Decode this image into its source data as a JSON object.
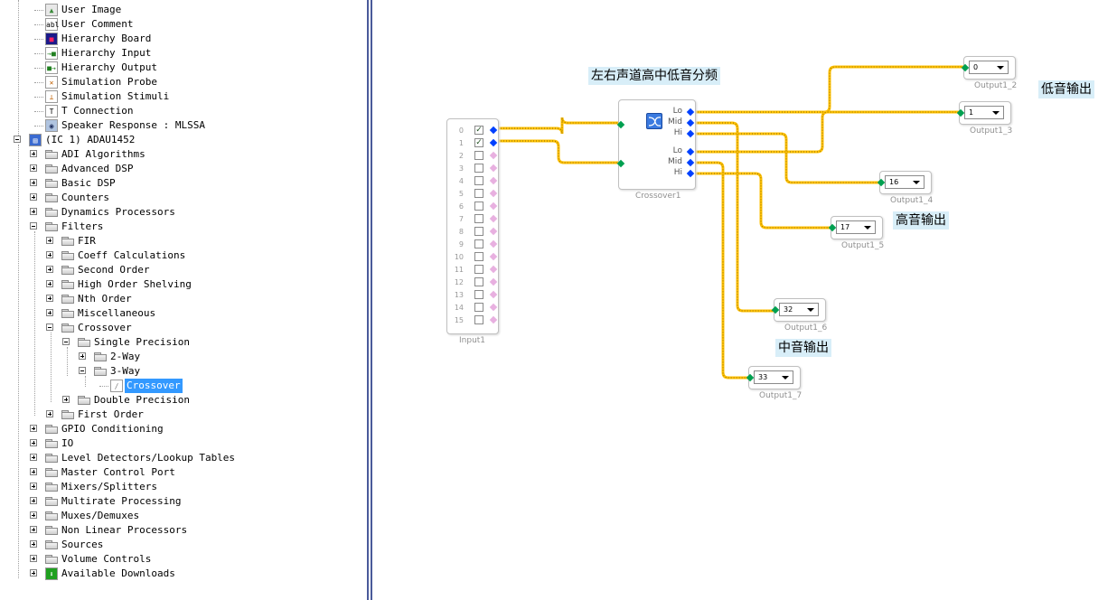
{
  "tree": {
    "items": [
      {
        "label": "User Image",
        "icon": "user-image-icon",
        "level": 1
      },
      {
        "label": "User Comment",
        "icon": "user-comment-icon",
        "level": 1
      },
      {
        "label": "Hierarchy Board",
        "icon": "hierarchy-board-icon",
        "level": 1
      },
      {
        "label": "Hierarchy Input",
        "icon": "hierarchy-input-icon",
        "level": 1
      },
      {
        "label": "Hierarchy Output",
        "icon": "hierarchy-output-icon",
        "level": 1
      },
      {
        "label": "Simulation Probe",
        "icon": "simulation-probe-icon",
        "level": 1
      },
      {
        "label": "Simulation Stimuli",
        "icon": "simulation-stimuli-icon",
        "level": 1
      },
      {
        "label": "T Connection",
        "icon": "t-connection-icon",
        "level": 1
      },
      {
        "label": "Speaker Response : MLSSA",
        "icon": "speaker-icon",
        "level": 1
      },
      {
        "label": "(IC 1) ADAU1452",
        "icon": "chip-icon",
        "level": 0,
        "expander": "minus"
      },
      {
        "label": "ADI Algorithms",
        "icon": "folder-icon",
        "level": 1,
        "expander": "plus"
      },
      {
        "label": "Advanced DSP",
        "icon": "folder-icon",
        "level": 1,
        "expander": "plus"
      },
      {
        "label": "Basic DSP",
        "icon": "folder-icon",
        "level": 1,
        "expander": "plus"
      },
      {
        "label": "Counters",
        "icon": "folder-icon",
        "level": 1,
        "expander": "plus"
      },
      {
        "label": "Dynamics Processors",
        "icon": "folder-icon",
        "level": 1,
        "expander": "plus"
      },
      {
        "label": "Filters",
        "icon": "folder-icon",
        "level": 1,
        "expander": "minus"
      },
      {
        "label": "FIR",
        "icon": "folder-icon",
        "level": 2,
        "expander": "plus"
      },
      {
        "label": "Coeff Calculations",
        "icon": "folder-icon",
        "level": 2,
        "expander": "plus"
      },
      {
        "label": "Second Order",
        "icon": "folder-icon",
        "level": 2,
        "expander": "plus"
      },
      {
        "label": "High Order Shelving",
        "icon": "folder-icon",
        "level": 2,
        "expander": "plus"
      },
      {
        "label": "Nth Order",
        "icon": "folder-icon",
        "level": 2,
        "expander": "plus"
      },
      {
        "label": "Miscellaneous",
        "icon": "folder-icon",
        "level": 2,
        "expander": "plus"
      },
      {
        "label": "Crossover",
        "icon": "folder-icon",
        "level": 2,
        "expander": "minus"
      },
      {
        "label": "Single Precision",
        "icon": "folder-icon",
        "level": 3,
        "expander": "minus"
      },
      {
        "label": "2-Way",
        "icon": "folder-icon",
        "level": 4,
        "expander": "plus"
      },
      {
        "label": "3-Way",
        "icon": "folder-icon",
        "level": 4,
        "expander": "minus"
      },
      {
        "label": "Crossover",
        "icon": "crossover-icon",
        "level": 5,
        "selected": true
      },
      {
        "label": "Double Precision",
        "icon": "folder-icon",
        "level": 3,
        "expander": "plus"
      },
      {
        "label": "First Order",
        "icon": "folder-icon",
        "level": 2,
        "expander": "plus"
      },
      {
        "label": "GPIO Conditioning",
        "icon": "folder-icon",
        "level": 1,
        "expander": "plus"
      },
      {
        "label": "IO",
        "icon": "folder-icon",
        "level": 1,
        "expander": "plus"
      },
      {
        "label": "Level Detectors/Lookup Tables",
        "icon": "folder-icon",
        "level": 1,
        "expander": "plus"
      },
      {
        "label": "Master Control Port",
        "icon": "folder-icon",
        "level": 1,
        "expander": "plus"
      },
      {
        "label": "Mixers/Splitters",
        "icon": "folder-icon",
        "level": 1,
        "expander": "plus"
      },
      {
        "label": "Multirate Processing",
        "icon": "folder-icon",
        "level": 1,
        "expander": "plus"
      },
      {
        "label": "Muxes/Demuxes",
        "icon": "folder-icon",
        "level": 1,
        "expander": "plus"
      },
      {
        "label": "Non Linear Processors",
        "icon": "folder-icon",
        "level": 1,
        "expander": "plus"
      },
      {
        "label": "Sources",
        "icon": "folder-icon",
        "level": 1,
        "expander": "plus"
      },
      {
        "label": "Volume Controls",
        "icon": "folder-icon",
        "level": 1,
        "expander": "plus"
      },
      {
        "label": "Available Downloads",
        "icon": "download-icon",
        "level": 1,
        "expander": "plus"
      }
    ]
  },
  "canvas": {
    "input_block": {
      "caption": "Input1",
      "channels": [
        "0",
        "1",
        "2",
        "3",
        "4",
        "5",
        "6",
        "7",
        "8",
        "9",
        "10",
        "11",
        "12",
        "13",
        "14",
        "15"
      ],
      "checked": [
        true,
        true,
        false,
        false,
        false,
        false,
        false,
        false,
        false,
        false,
        false,
        false,
        false,
        false,
        false,
        false
      ]
    },
    "crossover_block": {
      "caption": "Crossover1",
      "output_labels": [
        "Lo",
        "Mid",
        "Hi",
        "Lo",
        "Mid",
        "Hi"
      ]
    },
    "output_blocks": [
      {
        "caption": "Output1_2",
        "value": "0"
      },
      {
        "caption": "Output1_3",
        "value": "1"
      },
      {
        "caption": "Output1_4",
        "value": "16"
      },
      {
        "caption": "Output1_5",
        "value": "17"
      },
      {
        "caption": "Output1_6",
        "value": "32"
      },
      {
        "caption": "Output1_7",
        "value": "33"
      }
    ],
    "notes": {
      "title": "左右声道高中低音分频",
      "bass": "低音输出",
      "treble": "高音输出",
      "mid": "中音输出"
    },
    "wire_color": "#ffc000"
  }
}
